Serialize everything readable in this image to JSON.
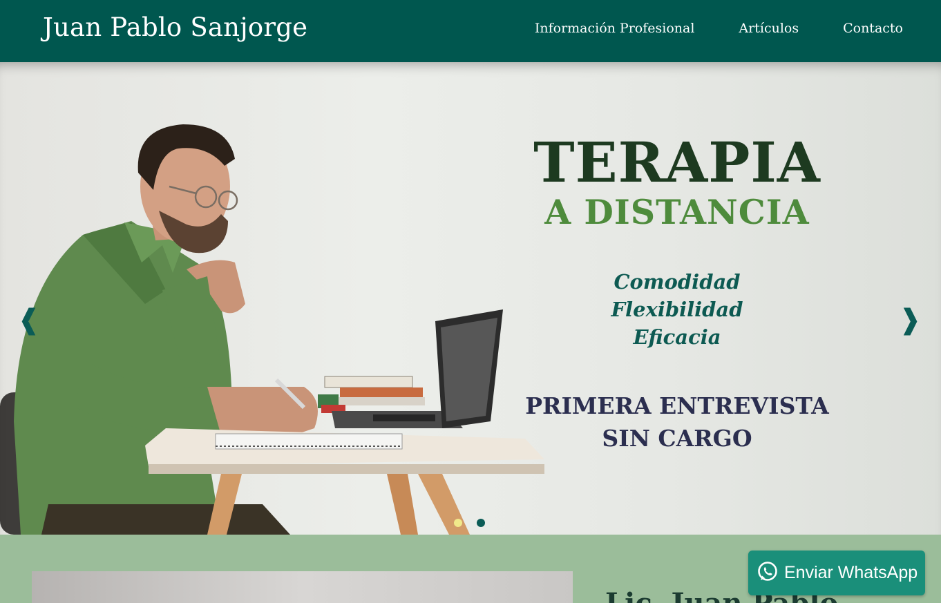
{
  "header": {
    "brand": "Juan Pablo Sanjorge",
    "nav": [
      {
        "label": "Información Profesional"
      },
      {
        "label": "Artículos"
      },
      {
        "label": "Contacto"
      }
    ]
  },
  "hero": {
    "title": "TERAPIA",
    "subtitle": "A DISTANCIA",
    "features": [
      "Comodidad",
      "Flexibilidad",
      "Eficacia"
    ],
    "cta_line1": "PRIMERA ENTREVISTA",
    "cta_line2": "SIN CARGO",
    "prev_icon": "chevron-left-icon",
    "next_icon": "chevron-right-icon",
    "slides_count": 2,
    "active_slide": 1
  },
  "about": {
    "title": "Lic. Juan Pablo"
  },
  "whatsapp": {
    "label": "Enviar WhatsApp",
    "icon": "whatsapp-icon"
  },
  "colors": {
    "header_bg": "#00574f",
    "section_bg": "#9bbd9a",
    "whatsapp_bg": "#1a8f7a",
    "accent_green": "#4e8b3c",
    "dark_green": "#1d3a20"
  }
}
